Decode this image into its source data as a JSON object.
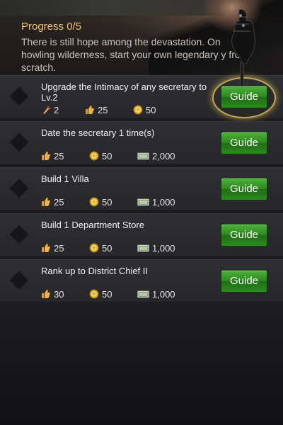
{
  "header": {
    "progress_label": "Progress 0/5",
    "story_text": "There is still hope among the devastation. On howling wilderness, start your own legendary y from scratch."
  },
  "tasks": [
    {
      "title": "Upgrade the Intimacy of any secretary to Lv.2",
      "guide_label": "Guide",
      "highlighted": true,
      "rewards": [
        {
          "icon": "syringe-icon",
          "value": "2"
        },
        {
          "icon": "thumbs-up-icon",
          "value": "25"
        },
        {
          "icon": "gold-coin-icon",
          "value": "50"
        }
      ]
    },
    {
      "title": "Date the secretary 1 time(s)",
      "guide_label": "Guide",
      "rewards": [
        {
          "icon": "thumbs-up-icon",
          "value": "25"
        },
        {
          "icon": "gold-coin-icon",
          "value": "50"
        },
        {
          "icon": "cash-icon",
          "value": "2,000"
        }
      ]
    },
    {
      "title": "Build 1 Villa",
      "guide_label": "Guide",
      "rewards": [
        {
          "icon": "thumbs-up-icon",
          "value": "25"
        },
        {
          "icon": "gold-coin-icon",
          "value": "50"
        },
        {
          "icon": "cash-icon",
          "value": "1,000"
        }
      ]
    },
    {
      "title": "Build 1 Department Store",
      "guide_label": "Guide",
      "rewards": [
        {
          "icon": "thumbs-up-icon",
          "value": "25"
        },
        {
          "icon": "gold-coin-icon",
          "value": "50"
        },
        {
          "icon": "cash-icon",
          "value": "1,000"
        }
      ]
    },
    {
      "title": "Rank up to District Chief II",
      "guide_label": "Guide",
      "rewards": [
        {
          "icon": "thumbs-up-icon",
          "value": "30"
        },
        {
          "icon": "gold-coin-icon",
          "value": "50"
        },
        {
          "icon": "cash-icon",
          "value": "1,000"
        }
      ]
    }
  ],
  "colors": {
    "accent_gold": "#f0c070",
    "button_green": "#2b8a1e"
  }
}
